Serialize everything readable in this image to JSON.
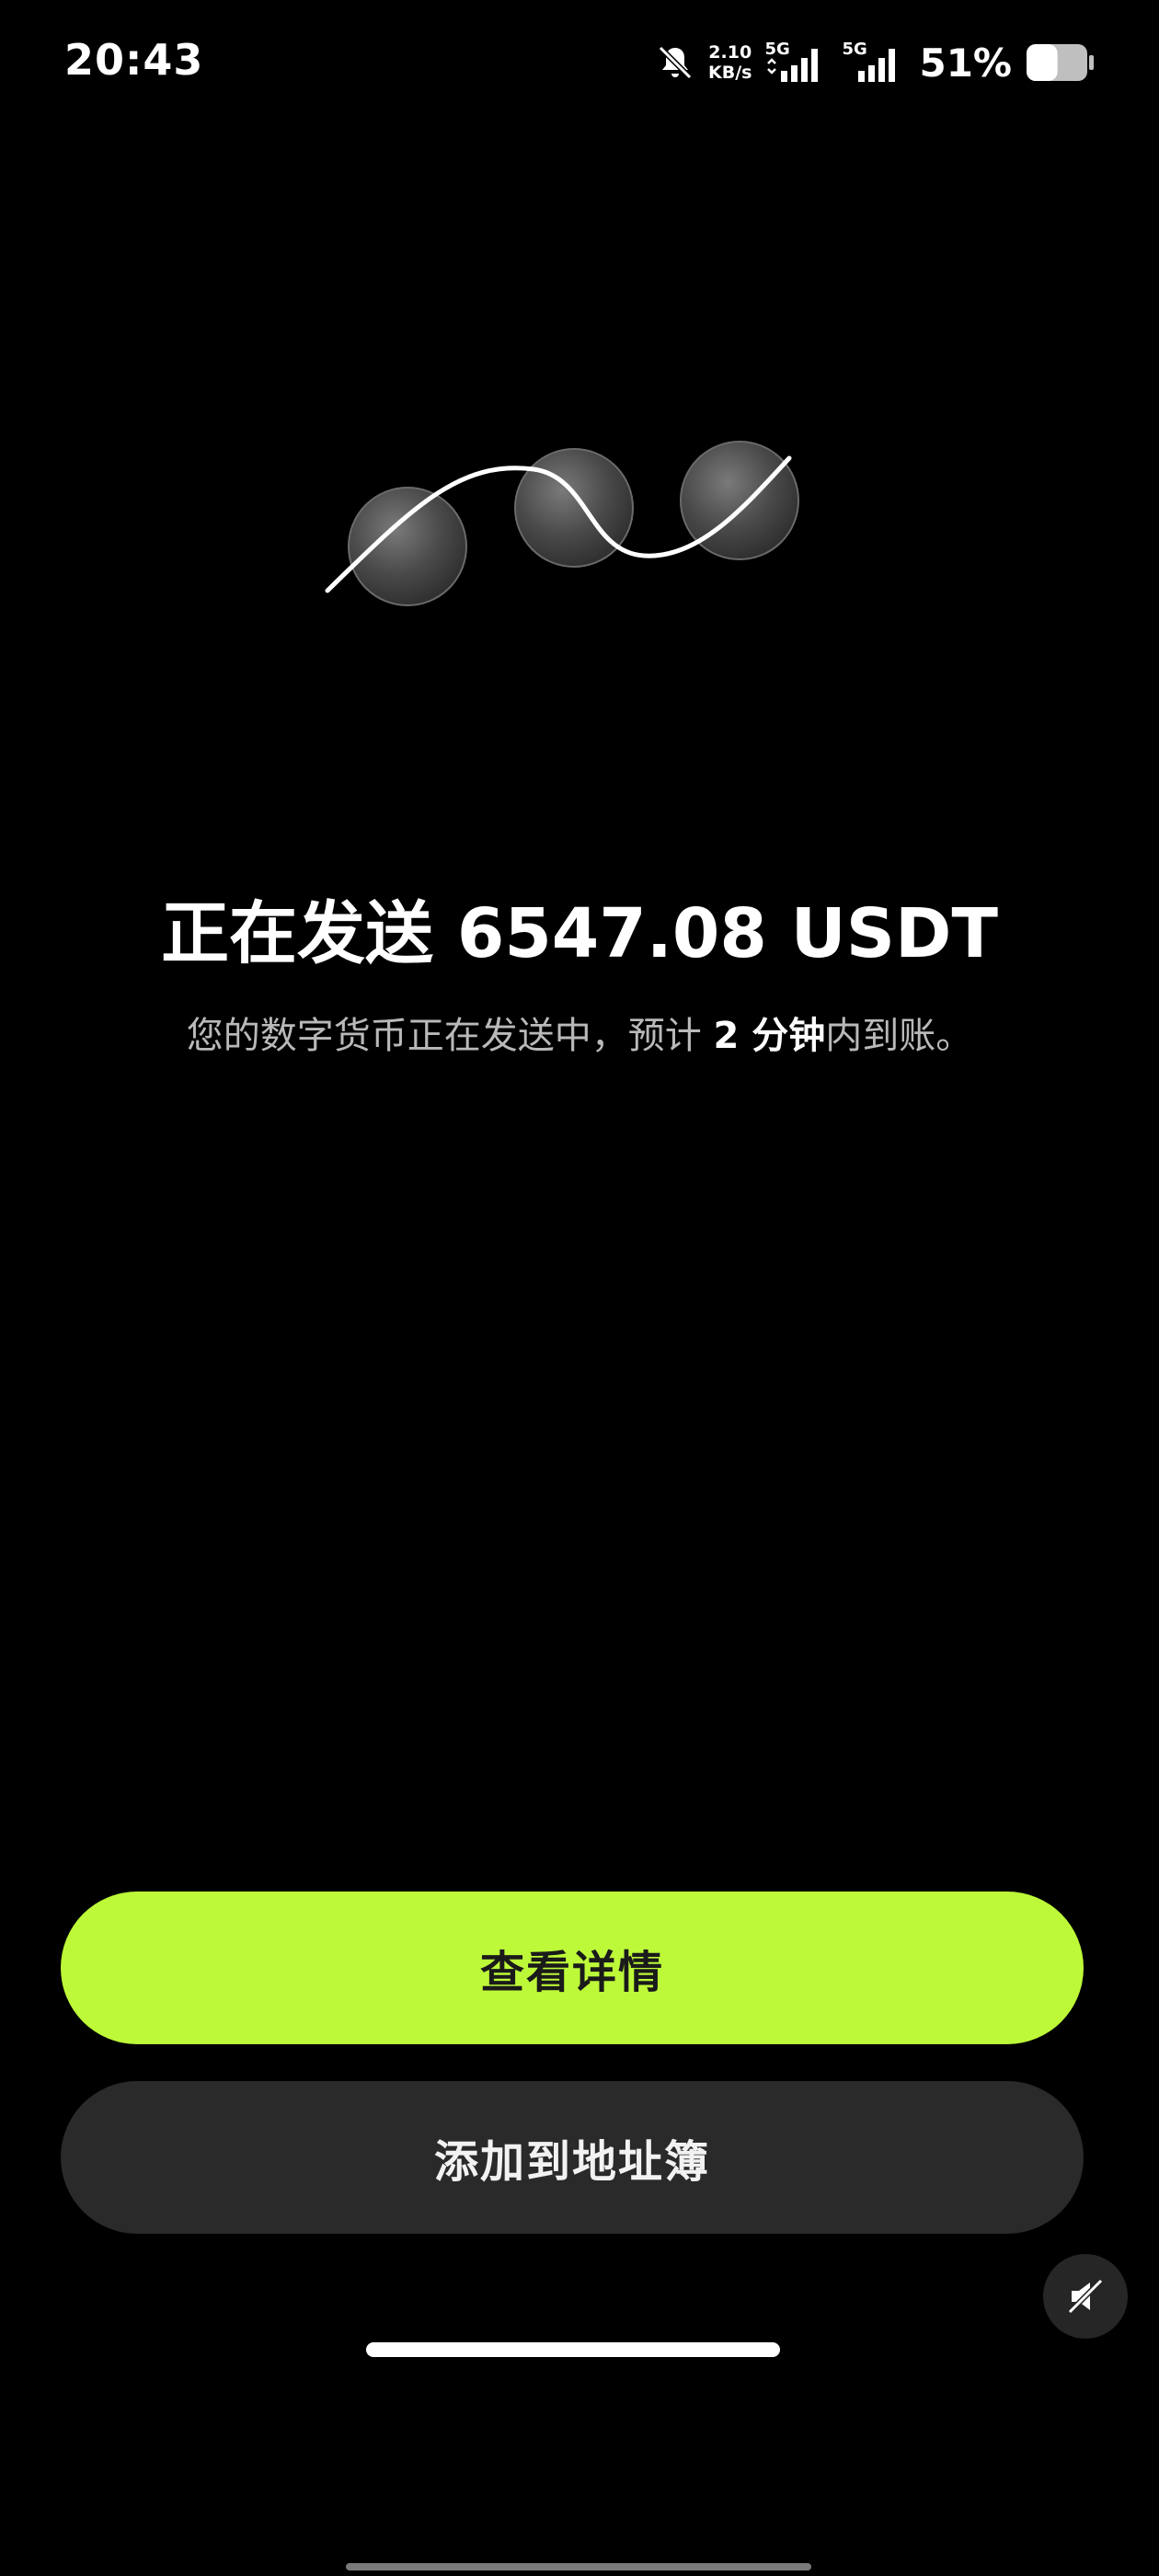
{
  "status_bar": {
    "time": "20:43",
    "net_speed_value": "2.10",
    "net_speed_unit": "KB/s",
    "sim1_label": "5G",
    "sim2_label": "5G",
    "battery_percent": "51%",
    "battery_level": 0.51,
    "icons": [
      "bell-muted-icon",
      "signal-icon",
      "battery-icon"
    ]
  },
  "transaction": {
    "title": "正在发送 6547.08 USDT",
    "subtitle_prefix": "您的数字货币正在发送中，预计 ",
    "subtitle_emphasis": "2 分钟",
    "subtitle_suffix": "内到账。"
  },
  "actions": {
    "view_details_label": "查看详情",
    "add_to_address_book_label": "添加到地址簿"
  },
  "floating_button": {
    "icon": "mute-speaker-icon"
  },
  "colors": {
    "background": "#000000",
    "primary_accent": "#bdf939",
    "secondary_button": "#2a2a2a",
    "subtitle_text": "#b9b9b9"
  }
}
